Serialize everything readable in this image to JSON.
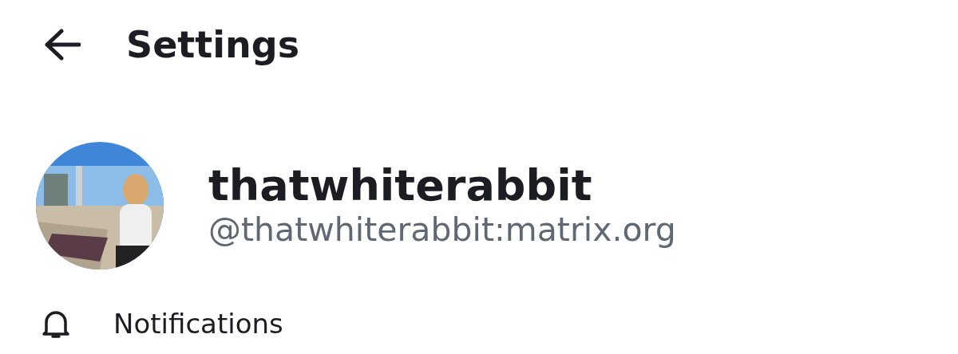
{
  "header": {
    "title": "Settings"
  },
  "profile": {
    "display_name": "thatwhiterabbit",
    "user_id": "@thatwhiterabbit:matrix.org"
  },
  "menu": [
    {
      "label": "Notifications"
    }
  ]
}
